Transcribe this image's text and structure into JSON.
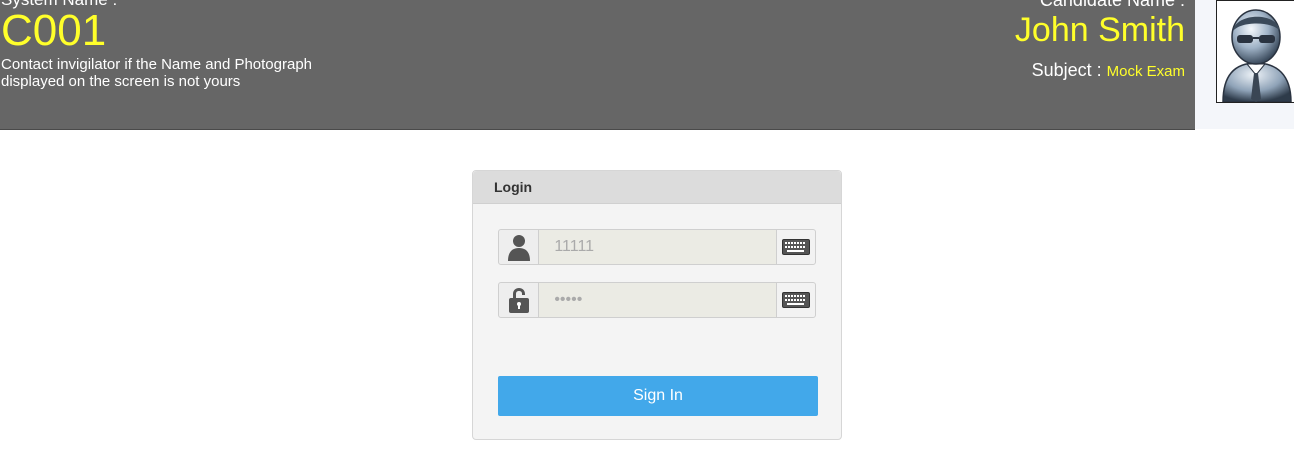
{
  "header": {
    "system_label": "System Name :",
    "system_name": "C001",
    "contact_note": "Contact invigilator if the Name and Photograph displayed on the screen is not yours",
    "candidate_label": "Candidate Name :",
    "candidate_name": "John Smith",
    "subject_label": "Subject :",
    "subject_value": "Mock Exam",
    "photo_icon": "candidate-avatar-icon"
  },
  "login": {
    "title": "Login",
    "username": {
      "value": "",
      "placeholder": "11111",
      "icon": "user-icon",
      "keyboard_icon": "keyboard-icon"
    },
    "password": {
      "value": "",
      "placeholder": "•••••",
      "icon": "lock-icon",
      "keyboard_icon": "keyboard-icon"
    },
    "signin_label": "Sign In"
  },
  "colors": {
    "header_bg": "#666666",
    "highlight_text": "#ffff2a",
    "signin_button": "#42a8ea"
  }
}
